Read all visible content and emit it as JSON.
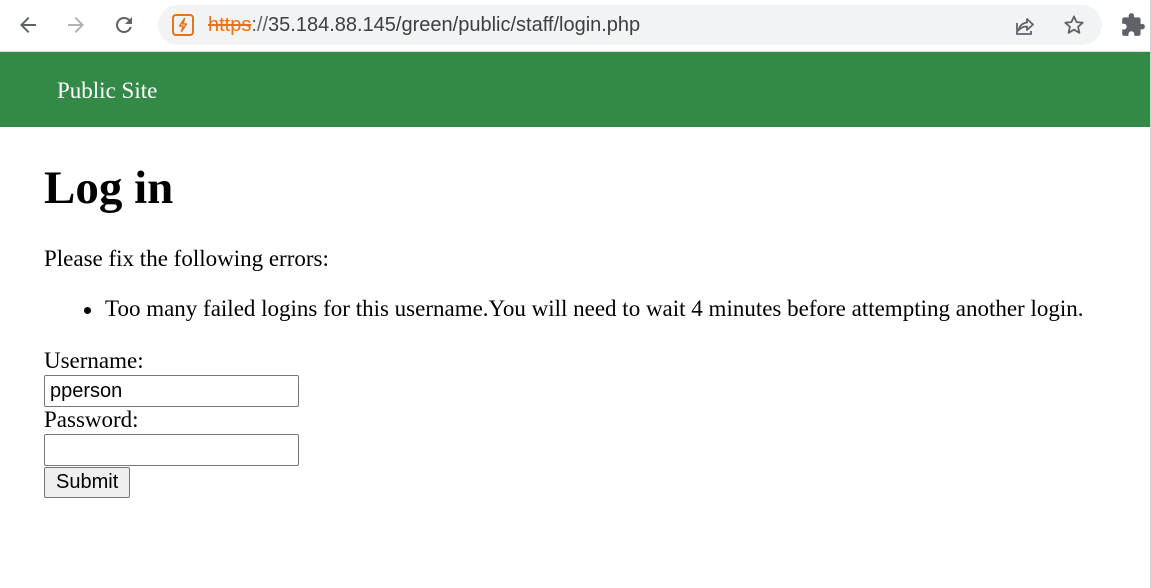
{
  "browser": {
    "url_scheme": "https",
    "url_separator": "://",
    "url_rest": "35.184.88.145/green/public/staff/login.php",
    "icons": {
      "back": "back-arrow-icon",
      "forward": "forward-arrow-icon",
      "reload": "reload-icon",
      "security": "not-secure-icon",
      "share": "share-icon",
      "bookmark": "star-icon",
      "extensions": "puzzle-piece-icon"
    }
  },
  "header": {
    "site_link": "Public Site",
    "background_color": "#338a46"
  },
  "main": {
    "title": "Log in",
    "errors_heading": "Please fix the following errors:",
    "errors": [
      "Too many failed logins for this username.You will need to wait 4 minutes before attempting another login."
    ],
    "form": {
      "username_label": "Username:",
      "username_value": "pperson",
      "password_label": "Password:",
      "password_value": "",
      "submit_label": "Submit"
    }
  }
}
